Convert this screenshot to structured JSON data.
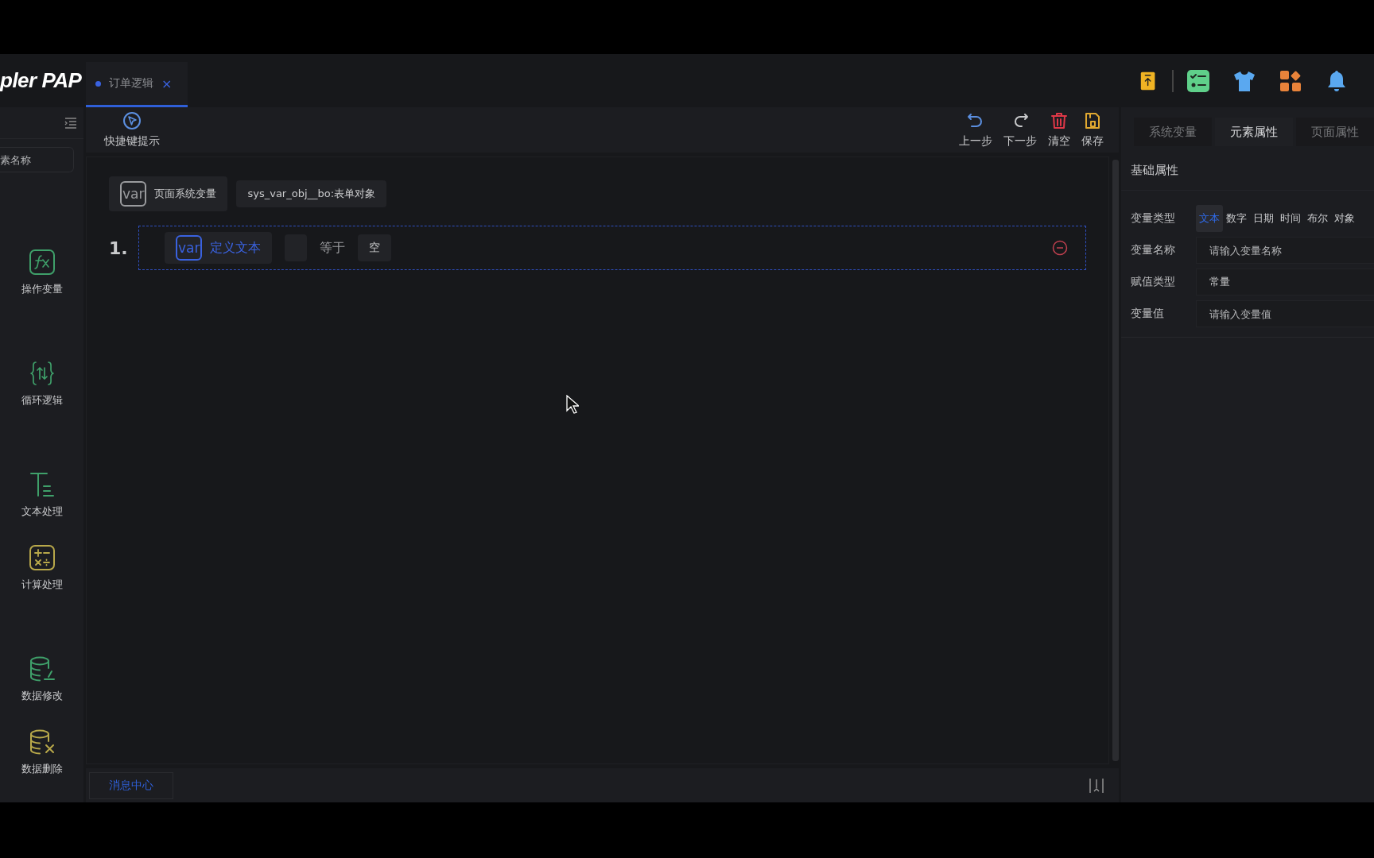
{
  "header": {
    "logo": "pler PAP",
    "tabs": [
      {
        "label": "订单逻辑",
        "selected": true,
        "close": "×"
      }
    ],
    "actions": [
      {
        "kind": "upload"
      },
      {
        "kind": "checklist"
      },
      {
        "kind": "shirt"
      },
      {
        "kind": "apps"
      },
      {
        "kind": "bell"
      }
    ]
  },
  "sidebar": {
    "search": {
      "placeholder": "素名称"
    },
    "groups": [
      [
        {
          "label": "操作变量",
          "kind": "fx"
        }
      ],
      [
        {
          "label": "循环逻辑",
          "kind": "loop"
        }
      ],
      [
        {
          "label": "文本处理",
          "kind": "text"
        },
        {
          "label": "计算处理",
          "kind": "calc"
        }
      ],
      [
        {
          "label": "数据修改",
          "kind": "dbedit"
        },
        {
          "label": "数据删除",
          "kind": "dbdelete"
        }
      ]
    ]
  },
  "toolbar": {
    "left": {
      "label": "快捷键提示",
      "kind": "hint"
    },
    "right": [
      {
        "label": "上一步",
        "kind": "undo"
      },
      {
        "label": "下一步",
        "kind": "redo"
      },
      {
        "label": "清空",
        "kind": "trash"
      },
      {
        "label": "保存",
        "kind": "save"
      }
    ]
  },
  "canvas": {
    "system_var": {
      "tag": "var",
      "label": "页面系统变量",
      "value": "sys_var_obj__bo:表单对象"
    },
    "rows": [
      {
        "number": "1.",
        "tag": "var",
        "name": "定义文本",
        "operator": "等于",
        "value": "空",
        "selected": true
      }
    ]
  },
  "bottom_bar": {
    "tab": "消息中心"
  },
  "panel": {
    "tabs": [
      {
        "label": "系统变量",
        "selected": false
      },
      {
        "label": "元素属性",
        "selected": true
      },
      {
        "label": "页面属性",
        "selected": false
      }
    ],
    "section": "基础属性",
    "fields": [
      {
        "label": "变量类型",
        "kind": "segmented",
        "options": [
          {
            "label": "文本",
            "selected": true
          },
          {
            "label": "数字",
            "selected": false
          },
          {
            "label": "日期",
            "selected": false
          },
          {
            "label": "时间",
            "selected": false
          },
          {
            "label": "布尔",
            "selected": false
          },
          {
            "label": "对象",
            "selected": false
          }
        ]
      },
      {
        "label": "变量名称",
        "kind": "input",
        "placeholder": "请输入变量名称"
      },
      {
        "label": "赋值类型",
        "kind": "select",
        "value": "常量"
      },
      {
        "label": "变量值",
        "kind": "input",
        "placeholder": "请输入变量值"
      }
    ]
  }
}
